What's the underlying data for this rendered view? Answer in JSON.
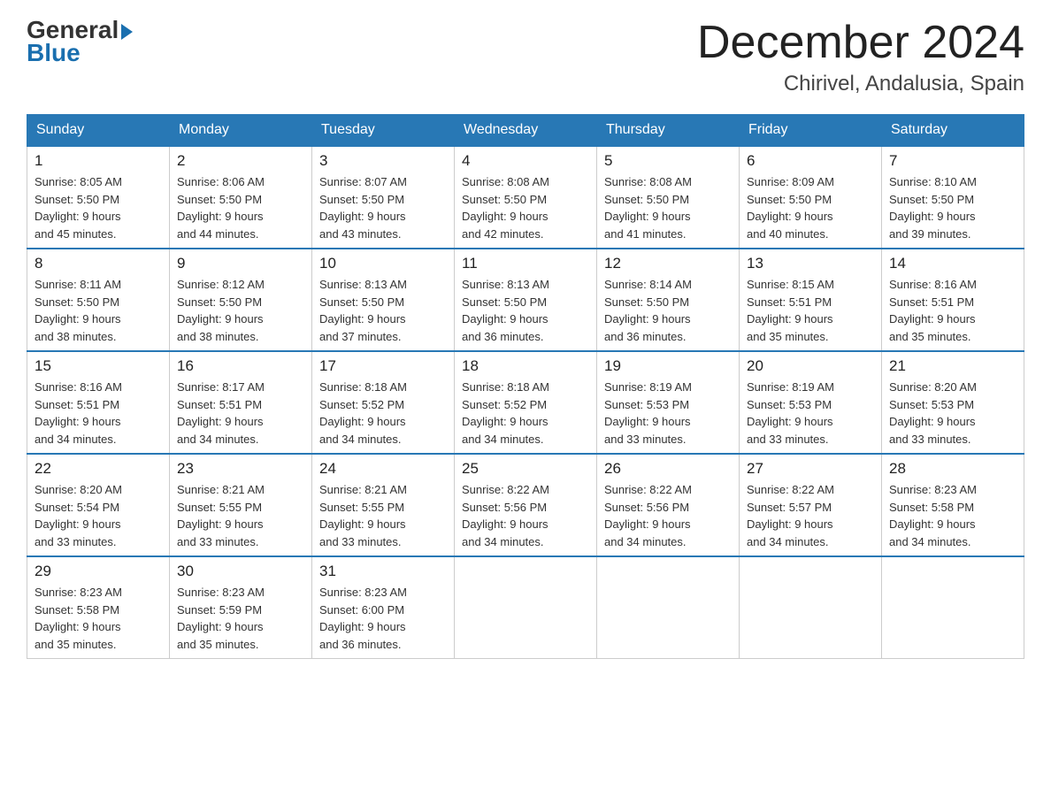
{
  "logo": {
    "general": "General",
    "blue": "Blue",
    "arrow": "▶"
  },
  "header": {
    "month_year": "December 2024",
    "location": "Chirivel, Andalusia, Spain"
  },
  "weekdays": [
    "Sunday",
    "Monday",
    "Tuesday",
    "Wednesday",
    "Thursday",
    "Friday",
    "Saturday"
  ],
  "weeks": [
    [
      {
        "day": "1",
        "sunrise": "8:05 AM",
        "sunset": "5:50 PM",
        "daylight": "9 hours and 45 minutes."
      },
      {
        "day": "2",
        "sunrise": "8:06 AM",
        "sunset": "5:50 PM",
        "daylight": "9 hours and 44 minutes."
      },
      {
        "day": "3",
        "sunrise": "8:07 AM",
        "sunset": "5:50 PM",
        "daylight": "9 hours and 43 minutes."
      },
      {
        "day": "4",
        "sunrise": "8:08 AM",
        "sunset": "5:50 PM",
        "daylight": "9 hours and 42 minutes."
      },
      {
        "day": "5",
        "sunrise": "8:08 AM",
        "sunset": "5:50 PM",
        "daylight": "9 hours and 41 minutes."
      },
      {
        "day": "6",
        "sunrise": "8:09 AM",
        "sunset": "5:50 PM",
        "daylight": "9 hours and 40 minutes."
      },
      {
        "day": "7",
        "sunrise": "8:10 AM",
        "sunset": "5:50 PM",
        "daylight": "9 hours and 39 minutes."
      }
    ],
    [
      {
        "day": "8",
        "sunrise": "8:11 AM",
        "sunset": "5:50 PM",
        "daylight": "9 hours and 38 minutes."
      },
      {
        "day": "9",
        "sunrise": "8:12 AM",
        "sunset": "5:50 PM",
        "daylight": "9 hours and 38 minutes."
      },
      {
        "day": "10",
        "sunrise": "8:13 AM",
        "sunset": "5:50 PM",
        "daylight": "9 hours and 37 minutes."
      },
      {
        "day": "11",
        "sunrise": "8:13 AM",
        "sunset": "5:50 PM",
        "daylight": "9 hours and 36 minutes."
      },
      {
        "day": "12",
        "sunrise": "8:14 AM",
        "sunset": "5:50 PM",
        "daylight": "9 hours and 36 minutes."
      },
      {
        "day": "13",
        "sunrise": "8:15 AM",
        "sunset": "5:51 PM",
        "daylight": "9 hours and 35 minutes."
      },
      {
        "day": "14",
        "sunrise": "8:16 AM",
        "sunset": "5:51 PM",
        "daylight": "9 hours and 35 minutes."
      }
    ],
    [
      {
        "day": "15",
        "sunrise": "8:16 AM",
        "sunset": "5:51 PM",
        "daylight": "9 hours and 34 minutes."
      },
      {
        "day": "16",
        "sunrise": "8:17 AM",
        "sunset": "5:51 PM",
        "daylight": "9 hours and 34 minutes."
      },
      {
        "day": "17",
        "sunrise": "8:18 AM",
        "sunset": "5:52 PM",
        "daylight": "9 hours and 34 minutes."
      },
      {
        "day": "18",
        "sunrise": "8:18 AM",
        "sunset": "5:52 PM",
        "daylight": "9 hours and 34 minutes."
      },
      {
        "day": "19",
        "sunrise": "8:19 AM",
        "sunset": "5:53 PM",
        "daylight": "9 hours and 33 minutes."
      },
      {
        "day": "20",
        "sunrise": "8:19 AM",
        "sunset": "5:53 PM",
        "daylight": "9 hours and 33 minutes."
      },
      {
        "day": "21",
        "sunrise": "8:20 AM",
        "sunset": "5:53 PM",
        "daylight": "9 hours and 33 minutes."
      }
    ],
    [
      {
        "day": "22",
        "sunrise": "8:20 AM",
        "sunset": "5:54 PM",
        "daylight": "9 hours and 33 minutes."
      },
      {
        "day": "23",
        "sunrise": "8:21 AM",
        "sunset": "5:55 PM",
        "daylight": "9 hours and 33 minutes."
      },
      {
        "day": "24",
        "sunrise": "8:21 AM",
        "sunset": "5:55 PM",
        "daylight": "9 hours and 33 minutes."
      },
      {
        "day": "25",
        "sunrise": "8:22 AM",
        "sunset": "5:56 PM",
        "daylight": "9 hours and 34 minutes."
      },
      {
        "day": "26",
        "sunrise": "8:22 AM",
        "sunset": "5:56 PM",
        "daylight": "9 hours and 34 minutes."
      },
      {
        "day": "27",
        "sunrise": "8:22 AM",
        "sunset": "5:57 PM",
        "daylight": "9 hours and 34 minutes."
      },
      {
        "day": "28",
        "sunrise": "8:23 AM",
        "sunset": "5:58 PM",
        "daylight": "9 hours and 34 minutes."
      }
    ],
    [
      {
        "day": "29",
        "sunrise": "8:23 AM",
        "sunset": "5:58 PM",
        "daylight": "9 hours and 35 minutes."
      },
      {
        "day": "30",
        "sunrise": "8:23 AM",
        "sunset": "5:59 PM",
        "daylight": "9 hours and 35 minutes."
      },
      {
        "day": "31",
        "sunrise": "8:23 AM",
        "sunset": "6:00 PM",
        "daylight": "9 hours and 36 minutes."
      },
      null,
      null,
      null,
      null
    ]
  ],
  "labels": {
    "sunrise": "Sunrise:",
    "sunset": "Sunset:",
    "daylight": "Daylight:"
  }
}
